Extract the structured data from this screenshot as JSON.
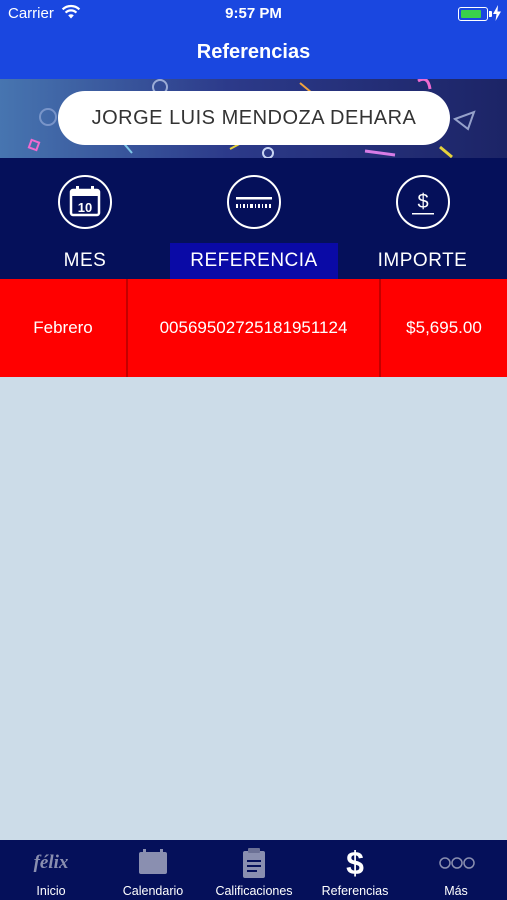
{
  "status_bar": {
    "carrier": "Carrier",
    "time": "9:57 PM"
  },
  "nav": {
    "title": "Referencias"
  },
  "student": {
    "name": "JORGE LUIS MENDOZA DEHARA"
  },
  "header": {
    "calendar_icon_text": "10",
    "columns": [
      {
        "label": "MES",
        "icon": "calendar-icon"
      },
      {
        "label": "REFERENCIA",
        "icon": "barcode-icon"
      },
      {
        "label": "IMPORTE",
        "icon": "dollar-icon"
      }
    ]
  },
  "rows": [
    {
      "mes": "Febrero",
      "referencia": "00569502725181951124",
      "importe": "$5,695.00"
    }
  ],
  "tabbar": {
    "items": [
      {
        "label": "Inicio",
        "icon": "felix-logo-icon",
        "logo_text": "félix"
      },
      {
        "label": "Calendario",
        "icon": "calendar-icon"
      },
      {
        "label": "Calificaciones",
        "icon": "clipboard-icon"
      },
      {
        "label": "Referencias",
        "icon": "dollar-icon"
      },
      {
        "label": "Más",
        "icon": "more-dots-icon"
      }
    ]
  },
  "colors": {
    "nav_blue": "#1a47e0",
    "header_navy": "#05105a",
    "active_column": "#0a0aa6",
    "row_red": "#ff0000",
    "content_bg": "#ccdce8"
  }
}
